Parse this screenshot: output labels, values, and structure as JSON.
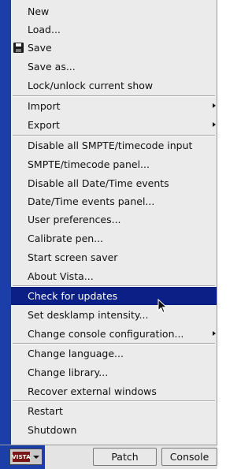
{
  "menu": {
    "items": [
      {
        "label": "New"
      },
      {
        "label": "Load..."
      },
      {
        "label": "Save",
        "icon": "save-icon"
      },
      {
        "label": "Save as..."
      },
      {
        "label": "Lock/unlock current show"
      },
      {
        "label": "Import",
        "submenu": true
      },
      {
        "label": "Export",
        "submenu": true
      },
      {
        "label": "Disable all SMPTE/timecode input"
      },
      {
        "label": "SMPTE/timecode panel..."
      },
      {
        "label": "Disable all Date/Time events"
      },
      {
        "label": "Date/Time events panel..."
      },
      {
        "label": "User preferences..."
      },
      {
        "label": "Calibrate pen..."
      },
      {
        "label": "Start screen saver"
      },
      {
        "label": "About Vista..."
      },
      {
        "label": "Check for updates",
        "selected": true
      },
      {
        "label": "Set desklamp intensity..."
      },
      {
        "label": "Change console configuration...",
        "submenu": true
      },
      {
        "label": "Change language..."
      },
      {
        "label": "Change library..."
      },
      {
        "label": "Recover external windows"
      },
      {
        "label": "Restart"
      },
      {
        "label": "Shutdown"
      }
    ]
  },
  "taskbar": {
    "vista_logo": "VISTA",
    "patch_label": "Patch",
    "console_label": "Console"
  },
  "colors": {
    "menu_bg": "#ebebeb",
    "selection": "#0b1f86",
    "frame_blue": "#1b3ea8"
  }
}
